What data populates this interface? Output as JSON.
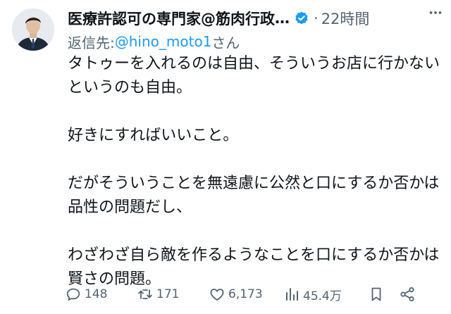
{
  "author": {
    "display_name": "医療許認可の専門家@筋肉行政",
    "truncation": "…",
    "separator": "·",
    "time": "22時間"
  },
  "reply_to": {
    "prefix": "返信先: ",
    "handle": "@hino_moto1",
    "suffix": "さん"
  },
  "body": {
    "paragraphs": [
      "タトゥーを入れるのは自由、そういうお店に行かないというのも自由。",
      "好きにすればいいこと。",
      "だがそういうことを無遠慮に公然と口にするか否かは品性の問題だし、",
      "わざわざ自ら敵を作るようなことを口にするか否かは賢さの問題。"
    ]
  },
  "actions": {
    "reply_count": "148",
    "repost_count": "171",
    "like_count": "6,173",
    "view_count": "45.4万"
  },
  "colors": {
    "text": "#0f1419",
    "secondary": "#536471",
    "accent": "#1d9bf0"
  },
  "icons": {
    "verified": "verified-badge-icon",
    "more": "more-icon",
    "reply": "reply-icon",
    "repost": "repost-icon",
    "like": "like-icon",
    "views": "views-icon",
    "bookmark": "bookmark-icon",
    "share": "share-icon"
  }
}
